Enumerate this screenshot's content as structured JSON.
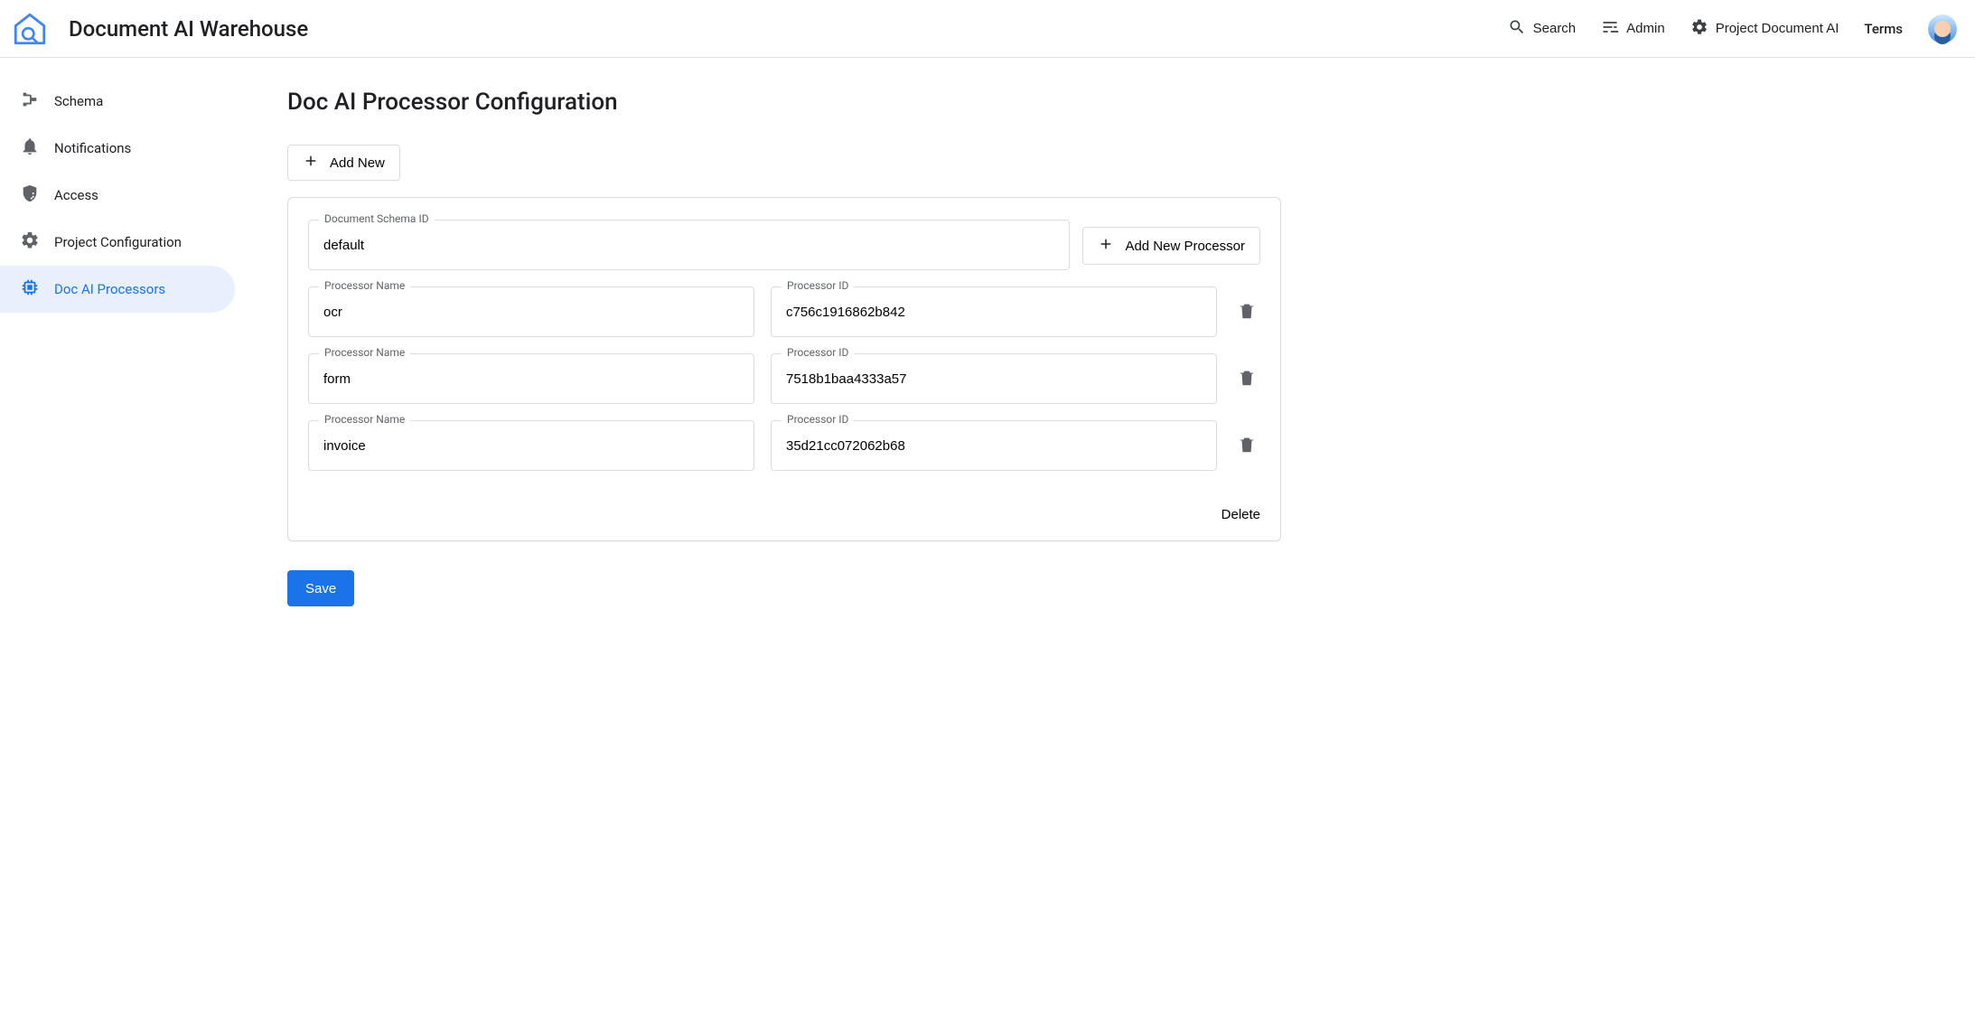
{
  "header": {
    "app_title": "Document AI Warehouse",
    "search": "Search",
    "admin": "Admin",
    "project": "Project Document AI",
    "terms": "Terms"
  },
  "sidebar": {
    "items": [
      {
        "label": "Schema"
      },
      {
        "label": "Notifications"
      },
      {
        "label": "Access"
      },
      {
        "label": "Project Configuration"
      },
      {
        "label": "Doc AI Processors"
      }
    ]
  },
  "page": {
    "title": "Doc AI Processor Configuration",
    "add_new": "Add New",
    "add_new_processor": "Add New Processor",
    "labels": {
      "schema_id": "Document Schema ID",
      "processor_name": "Processor Name",
      "processor_id": "Processor ID"
    },
    "schema_id_value": "default",
    "processors": [
      {
        "name": "ocr",
        "id": "c756c1916862b842"
      },
      {
        "name": "form",
        "id": "7518b1baa4333a57"
      },
      {
        "name": "invoice",
        "id": "35d21cc072062b68"
      }
    ],
    "delete": "Delete",
    "save": "Save"
  }
}
